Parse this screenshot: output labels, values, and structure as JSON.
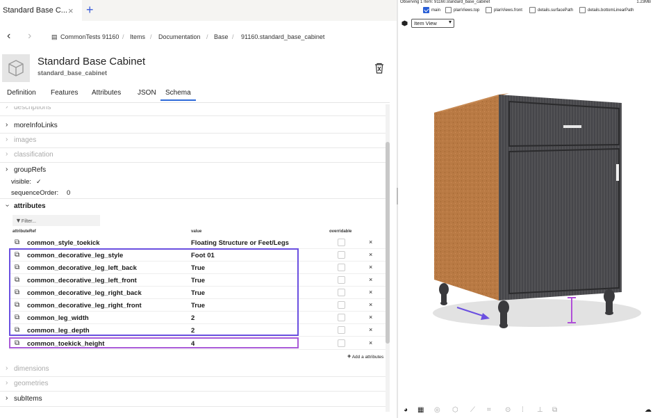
{
  "tab": {
    "title": "Standard Base C...",
    "close": "×",
    "new": "+"
  },
  "breadcrumb": [
    "CommonTests 91160",
    "Items",
    "Documentation",
    "Base",
    "91160.standard_base_cabinet"
  ],
  "item": {
    "title": "Standard Base Cabinet",
    "subtitle": "standard_base_cabinet"
  },
  "tabs": [
    "Definition",
    "Features",
    "Attributes",
    "JSON",
    "Schema"
  ],
  "active_tab": "Schema",
  "schema": {
    "descriptions": "descriptions",
    "moreInfoLinks": "moreInfoLinks",
    "images": "images",
    "classification": "classification",
    "groupRefs": "groupRefs",
    "visible_label": "visible:",
    "visible_value": "✓",
    "sequenceOrder_label": "sequenceOrder:",
    "sequenceOrder_value": "0",
    "attributes": "attributes",
    "filter_placeholder": "Filter...",
    "col_ref": "attributeRef",
    "col_value": "value",
    "col_overridable": "overridable",
    "add_attributes": "Add a attributes",
    "dimensions": "dimensions",
    "geometries": "geometries",
    "subItems": "subItems"
  },
  "attributes": [
    {
      "ref": "common_style_toekick",
      "value": "Floating Structure or Feet/Legs"
    },
    {
      "ref": "common_decorative_leg_style",
      "value": "Foot 01"
    },
    {
      "ref": "common_decorative_leg_left_back",
      "value": "True"
    },
    {
      "ref": "common_decorative_leg_left_front",
      "value": "True"
    },
    {
      "ref": "common_decorative_leg_right_back",
      "value": "True"
    },
    {
      "ref": "common_decorative_leg_right_front",
      "value": "True"
    },
    {
      "ref": "common_leg_width",
      "value": "2"
    },
    {
      "ref": "common_leg_depth",
      "value": "2"
    },
    {
      "ref": "common_toekick_height",
      "value": "4"
    }
  ],
  "viewer": {
    "observing": "Observing 1 Item: 91160.standard_base_cabinet",
    "size": "1.23MB",
    "layers": [
      {
        "name": "main",
        "checked": true
      },
      {
        "name": "planViews.top",
        "checked": false
      },
      {
        "name": "planViews.front",
        "checked": false
      },
      {
        "name": "details.surfacePath",
        "checked": false
      },
      {
        "name": "details.bottomLinearPath",
        "checked": false
      }
    ],
    "view_mode": "Item View"
  },
  "colors": {
    "accent": "#2d6ad9",
    "highlight_blue": "#6a4fe0",
    "highlight_purple": "#a95ad8",
    "cabinet_front": "#4a4a4c",
    "cabinet_side": "#b5743c"
  }
}
